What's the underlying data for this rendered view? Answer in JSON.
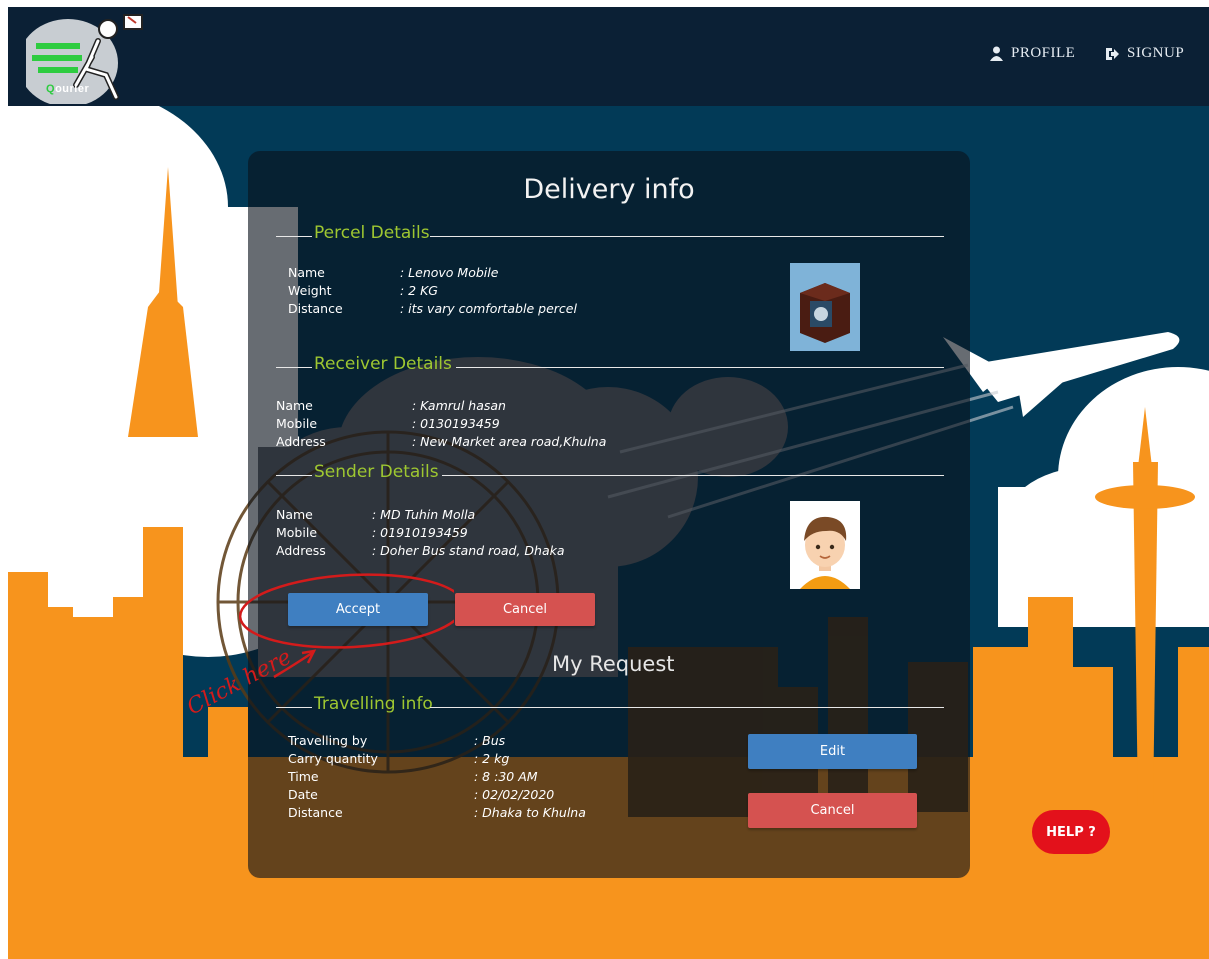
{
  "app": {
    "logo_q": "Q",
    "logo_rest": "ourier"
  },
  "nav": {
    "profile": "PROFILE",
    "signup": "SIGNUP"
  },
  "panel": {
    "title": "Delivery info"
  },
  "parcel": {
    "heading": "Percel Details",
    "rows": [
      {
        "label": "Name",
        "value": ": Lenovo Mobile"
      },
      {
        "label": "Weight",
        "value": ": 2 KG"
      },
      {
        "label": "Distance",
        "value": ": its vary comfortable percel"
      }
    ]
  },
  "receiver": {
    "heading": "Receiver Details",
    "rows": [
      {
        "label": "Name",
        "value": ": Kamrul hasan"
      },
      {
        "label": "Mobile",
        "value": ": 0130193459"
      },
      {
        "label": "Address",
        "value": ": New Market area road,Khulna"
      }
    ]
  },
  "sender": {
    "heading": "Sender Details",
    "rows": [
      {
        "label": "Name",
        "value": ": MD Tuhin Molla"
      },
      {
        "label": "Mobile",
        "value": ": 01910193459"
      },
      {
        "label": "Address",
        "value": ": Doher Bus stand road, Dhaka"
      }
    ]
  },
  "actions": {
    "accept": "Accept",
    "cancel": "Cancel"
  },
  "annotation": "Click here",
  "my_request": {
    "title": "My Request",
    "heading": "Travelling info",
    "rows": [
      {
        "label": "Travelling by",
        "value": ": Bus"
      },
      {
        "label": "Carry quantity",
        "value": ": 2 kg"
      },
      {
        "label": "Time",
        "value": ": 8 :30 AM"
      },
      {
        "label": "Date",
        "value": ": 02/02/2020"
      },
      {
        "label": "Distance",
        "value": ": Dhaka to Khulna"
      }
    ],
    "edit": "Edit",
    "cancel": "Cancel"
  },
  "help": "HELP ?",
  "colors": {
    "accent_green": "#9ec731",
    "button_blue": "#3f7fc1",
    "button_red": "#d55250",
    "help_red": "#e3111b",
    "city_orange": "#f7941d",
    "sky_blue": "#023a57"
  }
}
